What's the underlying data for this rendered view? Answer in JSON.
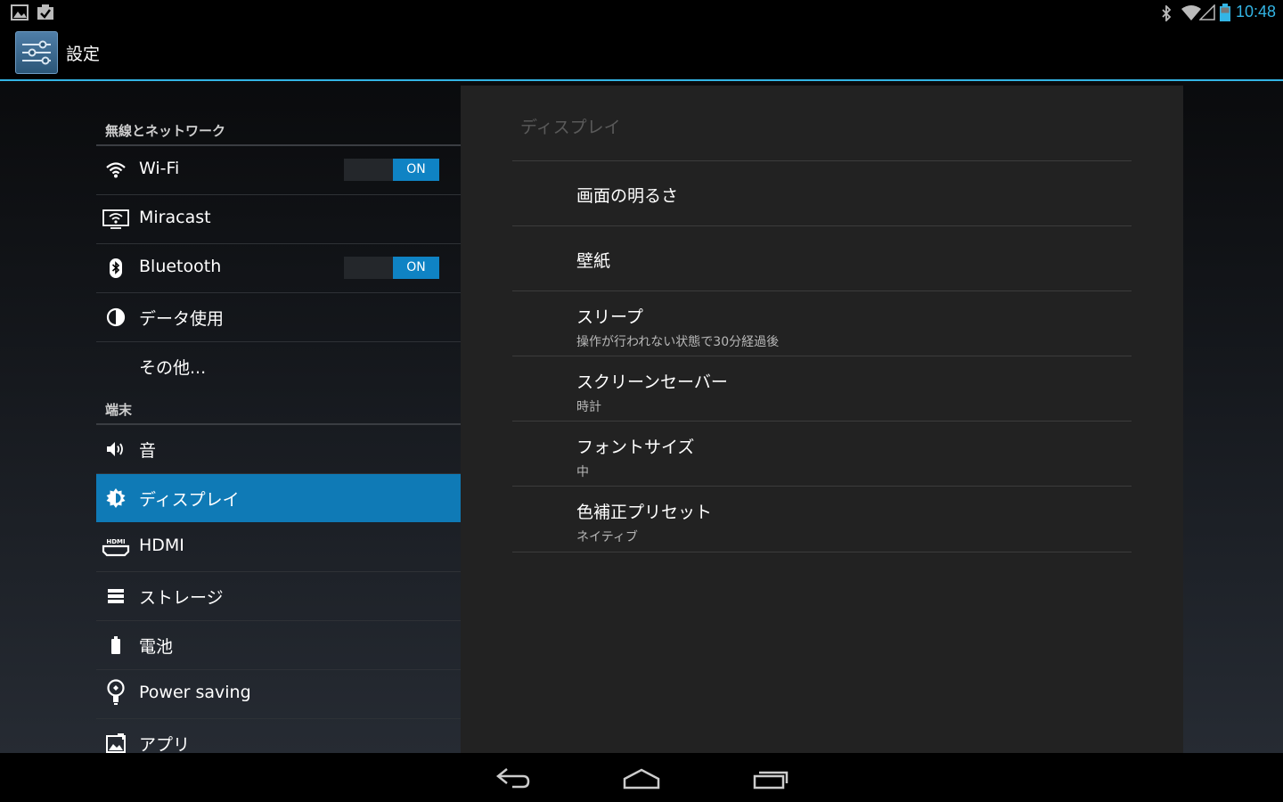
{
  "status_bar": {
    "left_icons": [
      "gallery-icon",
      "task-done-icon"
    ],
    "right_icons": [
      "bluetooth-icon",
      "wifi-signal-icon",
      "cell-signal-icon",
      "battery-icon"
    ],
    "time": "10:48"
  },
  "action_bar": {
    "title": "設定",
    "icon": "settings-icon"
  },
  "sidebar": {
    "sections": [
      {
        "header": "無線とネットワーク"
      },
      {
        "header": "端末"
      }
    ],
    "items": [
      {
        "label": "Wi-Fi",
        "icon": "wifi-icon",
        "toggle": "ON"
      },
      {
        "label": "Miracast",
        "icon": "miracast-icon"
      },
      {
        "label": "Bluetooth",
        "icon": "bluetooth-icon",
        "toggle": "ON"
      },
      {
        "label": "データ使用",
        "icon": "data-usage-icon"
      },
      {
        "label": "その他..."
      },
      {
        "label": "音",
        "icon": "sound-icon"
      },
      {
        "label": "ディスプレイ",
        "icon": "display-icon",
        "active": true
      },
      {
        "label": "HDMI",
        "icon": "hdmi-icon"
      },
      {
        "label": "ストレージ",
        "icon": "storage-icon"
      },
      {
        "label": "電池",
        "icon": "battery-icon"
      },
      {
        "label": "Power saving",
        "icon": "power-saving-icon"
      },
      {
        "label": "アプリ",
        "icon": "apps-icon"
      }
    ]
  },
  "panel": {
    "title": "ディスプレイ",
    "items": [
      {
        "title": "画面の明るさ"
      },
      {
        "title": "壁紙"
      },
      {
        "title": "スリープ",
        "summary": "操作が行われない状態で30分経過後"
      },
      {
        "title": "スクリーンセーバー",
        "summary": "時計"
      },
      {
        "title": "フォントサイズ",
        "summary": "中"
      },
      {
        "title": "色補正プリセット",
        "summary": "ネイティブ"
      }
    ]
  },
  "nav_bar": {
    "icons": [
      "back-icon",
      "home-icon",
      "recent-apps-icon"
    ]
  },
  "colors": {
    "accent": "#33b5e5",
    "selected": "#0f7ab6",
    "toggle_on": "#0f83c4"
  }
}
